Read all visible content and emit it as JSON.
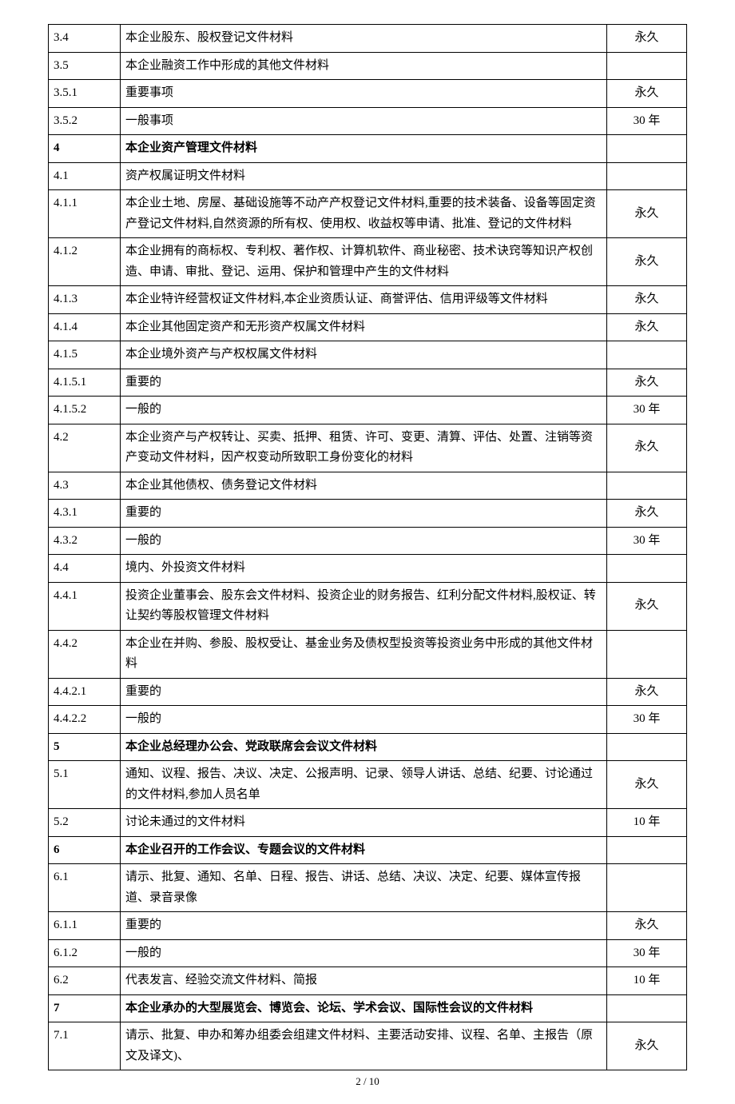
{
  "footer": "2 / 10",
  "rows": [
    {
      "num": "3.4",
      "desc": "本企业股东、股权登记文件材料",
      "ret": "永久",
      "bold": false
    },
    {
      "num": "3.5",
      "desc": "本企业融资工作中形成的其他文件材料",
      "ret": "",
      "bold": false
    },
    {
      "num": "3.5.1",
      "desc": "重要事项",
      "ret": "永久",
      "bold": false
    },
    {
      "num": "3.5.2",
      "desc": "一般事项",
      "ret": "30 年",
      "bold": false
    },
    {
      "num": "4",
      "desc": "本企业资产管理文件材料",
      "ret": "",
      "bold": true
    },
    {
      "num": "4.1",
      "desc": "资产权属证明文件材料",
      "ret": "",
      "bold": false
    },
    {
      "num": "4.1.1",
      "desc": "本企业土地、房屋、基础设施等不动产产权登记文件材料,重要的技术装备、设备等固定资产登记文件材料,自然资源的所有权、使用权、收益权等申请、批准、登记的文件材料",
      "ret": "永久",
      "bold": false
    },
    {
      "num": "4.1.2",
      "desc": "本企业拥有的商标权、专利权、著作权、计算机软件、商业秘密、技术诀窍等知识产权创造、申请、审批、登记、运用、保护和管理中产生的文件材料",
      "ret": "永久",
      "bold": false
    },
    {
      "num": "4.1.3",
      "desc": "本企业特许经营权证文件材料,本企业资质认证、商誉评估、信用评级等文件材料",
      "ret": "永久",
      "bold": false
    },
    {
      "num": "4.1.4",
      "desc": "本企业其他固定资产和无形资产权属文件材料",
      "ret": "永久",
      "bold": false
    },
    {
      "num": "4.1.5",
      "desc": "本企业境外资产与产权权属文件材料",
      "ret": "",
      "bold": false
    },
    {
      "num": "4.1.5.1",
      "desc": "重要的",
      "ret": "永久",
      "bold": false
    },
    {
      "num": "4.1.5.2",
      "desc": "一般的",
      "ret": "30 年",
      "bold": false
    },
    {
      "num": "4.2",
      "desc": "本企业资产与产权转让、买卖、抵押、租赁、许可、变更、清算、评估、处置、注销等资产变动文件材料，因产权变动所致职工身份变化的材料",
      "ret": "永久",
      "bold": false
    },
    {
      "num": "4.3",
      "desc": "本企业其他债权、债务登记文件材料",
      "ret": "",
      "bold": false
    },
    {
      "num": "4.3.1",
      "desc": "重要的",
      "ret": "永久",
      "bold": false
    },
    {
      "num": "4.3.2",
      "desc": "一般的",
      "ret": "30 年",
      "bold": false
    },
    {
      "num": "4.4",
      "desc": "境内、外投资文件材料",
      "ret": "",
      "bold": false
    },
    {
      "num": "4.4.1",
      "desc": "投资企业董事会、股东会文件材料、投资企业的财务报告、红利分配文件材料,股权证、转让契约等股权管理文件材料",
      "ret": "永久",
      "bold": false
    },
    {
      "num": "4.4.2",
      "desc": "本企业在并购、参股、股权受让、基金业务及债权型投资等投资业务中形成的其他文件材料",
      "ret": "",
      "bold": false
    },
    {
      "num": "4.4.2.1",
      "desc": "重要的",
      "ret": "永久",
      "bold": false
    },
    {
      "num": "4.4.2.2",
      "desc": "一般的",
      "ret": "30 年",
      "bold": false
    },
    {
      "num": "5",
      "desc": "本企业总经理办公会、党政联席会会议文件材料",
      "ret": "",
      "bold": true
    },
    {
      "num": "5.1",
      "desc": "通知、议程、报告、决议、决定、公报声明、记录、领导人讲话、总结、纪要、讨论通过的文件材料,参加人员名单",
      "ret": "永久",
      "bold": false
    },
    {
      "num": "5.2",
      "desc": "讨论未通过的文件材料",
      "ret": "10 年",
      "bold": false
    },
    {
      "num": "6",
      "desc": "本企业召开的工作会议、专题会议的文件材料",
      "ret": "",
      "bold": true
    },
    {
      "num": "6.1",
      "desc": "请示、批复、通知、名单、日程、报告、讲话、总结、决议、决定、纪要、媒体宣传报道、录音录像",
      "ret": "",
      "bold": false
    },
    {
      "num": "6.1.1",
      "desc": "重要的",
      "ret": "永久",
      "bold": false
    },
    {
      "num": "6.1.2",
      "desc": "一般的",
      "ret": "30 年",
      "bold": false
    },
    {
      "num": "6.2",
      "desc": "代表发言、经验交流文件材料、简报",
      "ret": "10 年",
      "bold": false
    },
    {
      "num": "7",
      "desc": "本企业承办的大型展览会、博览会、论坛、学术会议、国际性会议的文件材料",
      "ret": "",
      "bold": true
    },
    {
      "num": "7.1",
      "desc": "请示、批复、申办和筹办组委会组建文件材料、主要活动安排、议程、名单、主报告（原文及译文)、",
      "ret": "永久",
      "bold": false
    }
  ]
}
